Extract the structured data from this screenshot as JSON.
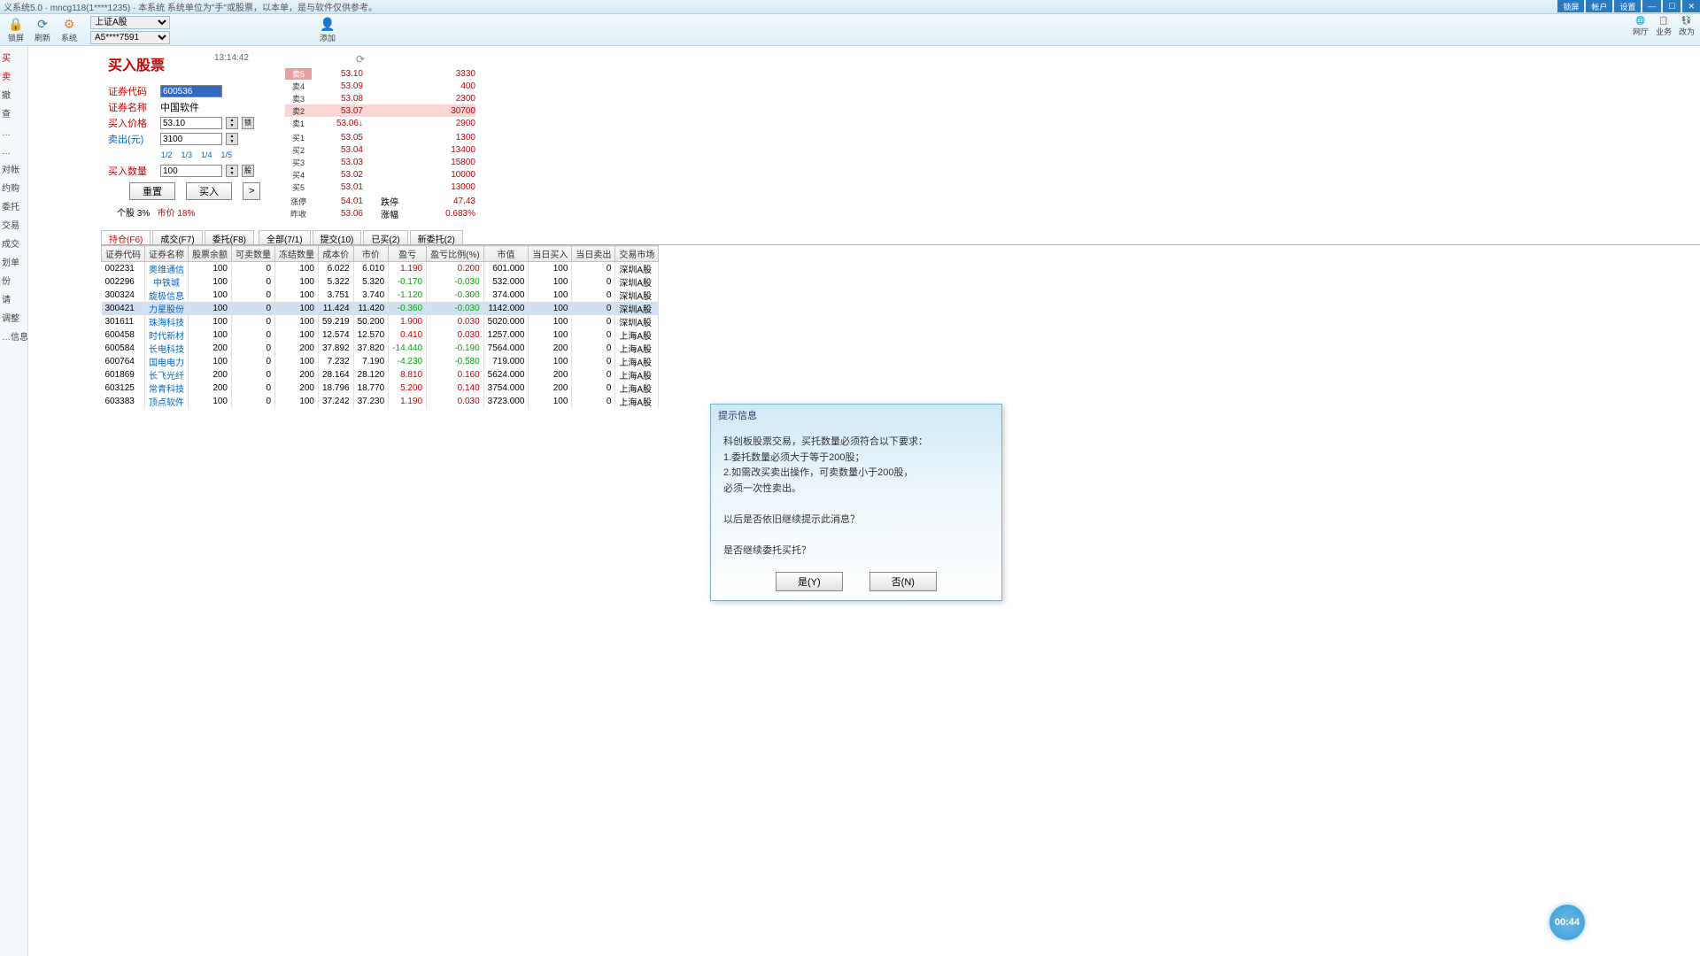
{
  "title": "义系统5.0 · mncg118(1****1235) · 本系统 系统单位为\"手\"或股票，以本单，是与软件仅供参考。",
  "title_buttons": [
    "锁屏",
    "帐户",
    "设置",
    "—",
    "☐",
    "✕"
  ],
  "toolbar": {
    "items": [
      {
        "icon": "🔒",
        "label": "锁屏",
        "cls": "blue"
      },
      {
        "icon": "⟳",
        "label": "刷新",
        "cls": "blue"
      },
      {
        "icon": "⚙",
        "label": "系统",
        "cls": "orange"
      }
    ],
    "market_select": "上证A股",
    "account_select": "A5****7591",
    "add_user": {
      "label": "添加"
    },
    "right": [
      {
        "icon": "🌐",
        "label": "网厅"
      },
      {
        "icon": "📋",
        "label": "业务"
      },
      {
        "icon": "💱",
        "label": "改为"
      }
    ]
  },
  "sidebar": [
    "买",
    "卖",
    "撤",
    "查",
    "…",
    "…",
    "对帐",
    "约购",
    "委托",
    "交易",
    "成交",
    "划单",
    "份",
    "请",
    "调整",
    "…信息"
  ],
  "buy_panel": {
    "title": "买入股票",
    "time": "13:14:42",
    "rows": {
      "code_label": "证券代码",
      "code_value": "600536",
      "name_label": "证券名称",
      "name_value": "中国软件",
      "price_label": "买入价格",
      "price_value": "53.10",
      "limit_label": "卖出(元)",
      "limit_value": "3100",
      "qty_label": "买入数量",
      "qty_value": "100"
    },
    "fractions": [
      "1/2",
      "1/3",
      "1/4",
      "1/5"
    ],
    "reset_btn": "重置",
    "buy_btn": "买入",
    "arrow": ">",
    "pct_line": {
      "a": "个股 3%",
      "b": "市价 18%"
    }
  },
  "quote": {
    "sells": [
      {
        "l": "卖5",
        "p": "53.10",
        "v": "3330",
        "pc": "red"
      },
      {
        "l": "卖4",
        "p": "53.09",
        "v": "400",
        "pc": "red"
      },
      {
        "l": "卖3",
        "p": "53.08",
        "v": "2300",
        "pc": "red"
      },
      {
        "l": "卖2",
        "p": "53.07",
        "v": "30700",
        "pc": "red",
        "hl": true
      },
      {
        "l": "卖1",
        "p": "53.06↓",
        "v": "2900",
        "pc": "red"
      }
    ],
    "buys": [
      {
        "l": "买1",
        "p": "53.05",
        "v": "1300",
        "pc": "red"
      },
      {
        "l": "买2",
        "p": "53.04",
        "v": "13400",
        "pc": "red"
      },
      {
        "l": "买3",
        "p": "53.03",
        "v": "15800",
        "pc": "red"
      },
      {
        "l": "买4",
        "p": "53.02",
        "v": "10000",
        "pc": "red"
      },
      {
        "l": "买5",
        "p": "53.01",
        "v": "13000",
        "pc": "red"
      }
    ],
    "summary": [
      {
        "l": "涨停",
        "p": "54.01",
        "l2": "跌停",
        "v": "47.43",
        "pc": "red"
      },
      {
        "l": "昨收",
        "p": "53.06",
        "l2": "涨幅",
        "v": "0.683%",
        "pc": "red"
      }
    ]
  },
  "tabs1": [
    {
      "t": "持仓(F6)",
      "a": true
    },
    {
      "t": "成交(F7)"
    },
    {
      "t": "委托(F8)"
    }
  ],
  "tabs2": [
    {
      "t": "全部(7/1)"
    },
    {
      "t": "提交(10)"
    },
    {
      "t": "已买(2)"
    },
    {
      "t": "新委托(2)"
    }
  ],
  "grid": {
    "headers": [
      "证券代码",
      "证券名称",
      "股票余额",
      "可卖数量",
      "冻结数量",
      "成本价",
      "市价",
      "盈亏",
      "盈亏比例(%)",
      "市值",
      "当日买入",
      "当日卖出",
      "交易市场"
    ],
    "rows": [
      [
        "002231",
        "奥维通信",
        "100",
        "0",
        "100",
        "6.022",
        "6.010",
        "1.190",
        "0.200",
        "601.000",
        "100",
        "0",
        "深圳A股"
      ],
      [
        "002296",
        "中铁城",
        "100",
        "0",
        "100",
        "5.322",
        "5.320",
        "-0.170",
        "-0.030",
        "532.000",
        "100",
        "0",
        "深圳A股"
      ],
      [
        "300324",
        "旋极信息",
        "100",
        "0",
        "100",
        "3.751",
        "3.740",
        "-1.120",
        "-0.300",
        "374.000",
        "100",
        "0",
        "深圳A股"
      ],
      [
        "300421",
        "力星股份",
        "100",
        "0",
        "100",
        "11.424",
        "11.420",
        "-0.360",
        "-0.030",
        "1142.000",
        "100",
        "0",
        "深圳A股"
      ],
      [
        "301611",
        "珠海科技",
        "100",
        "0",
        "100",
        "59.219",
        "50.200",
        "1.900",
        "0.030",
        "5020.000",
        "100",
        "0",
        "深圳A股"
      ],
      [
        "600458",
        "时代新材",
        "100",
        "0",
        "100",
        "12.574",
        "12.570",
        "0.410",
        "0.030",
        "1257.000",
        "100",
        "0",
        "上海A股"
      ],
      [
        "600584",
        "长电科技",
        "200",
        "0",
        "200",
        "37.892",
        "37.820",
        "-14.440",
        "-0.190",
        "7564.000",
        "200",
        "0",
        "上海A股"
      ],
      [
        "600764",
        "国电电力",
        "100",
        "0",
        "100",
        "7.232",
        "7.190",
        "-4.230",
        "-0.580",
        "719.000",
        "100",
        "0",
        "上海A股"
      ],
      [
        "601869",
        "长飞光纤",
        "200",
        "0",
        "200",
        "28.164",
        "28.120",
        "8.810",
        "0.160",
        "5624.000",
        "200",
        "0",
        "上海A股"
      ],
      [
        "603125",
        "常青科技",
        "200",
        "0",
        "200",
        "18.796",
        "18.770",
        "5.200",
        "0.140",
        "3754.000",
        "200",
        "0",
        "上海A股"
      ],
      [
        "603383",
        "顶点软件",
        "100",
        "0",
        "100",
        "37.242",
        "37.230",
        "1.190",
        "0.030",
        "3723.000",
        "100",
        "0",
        "上海A股"
      ]
    ],
    "selected": 3
  },
  "dialog": {
    "title": "提示信息",
    "lines": [
      "科创板股票交易，买托数量必须符合以下要求：",
      "1.委托数量必须大于等于200股；",
      "2.如需改买卖出操作，可卖数量小于200股，",
      "必须一次性卖出。",
      "",
      "以后是否依旧继续提示此消息？",
      "",
      "是否继续委托买托？"
    ],
    "yes": "是(Y)",
    "no": "否(N)"
  },
  "timer": "00:44"
}
